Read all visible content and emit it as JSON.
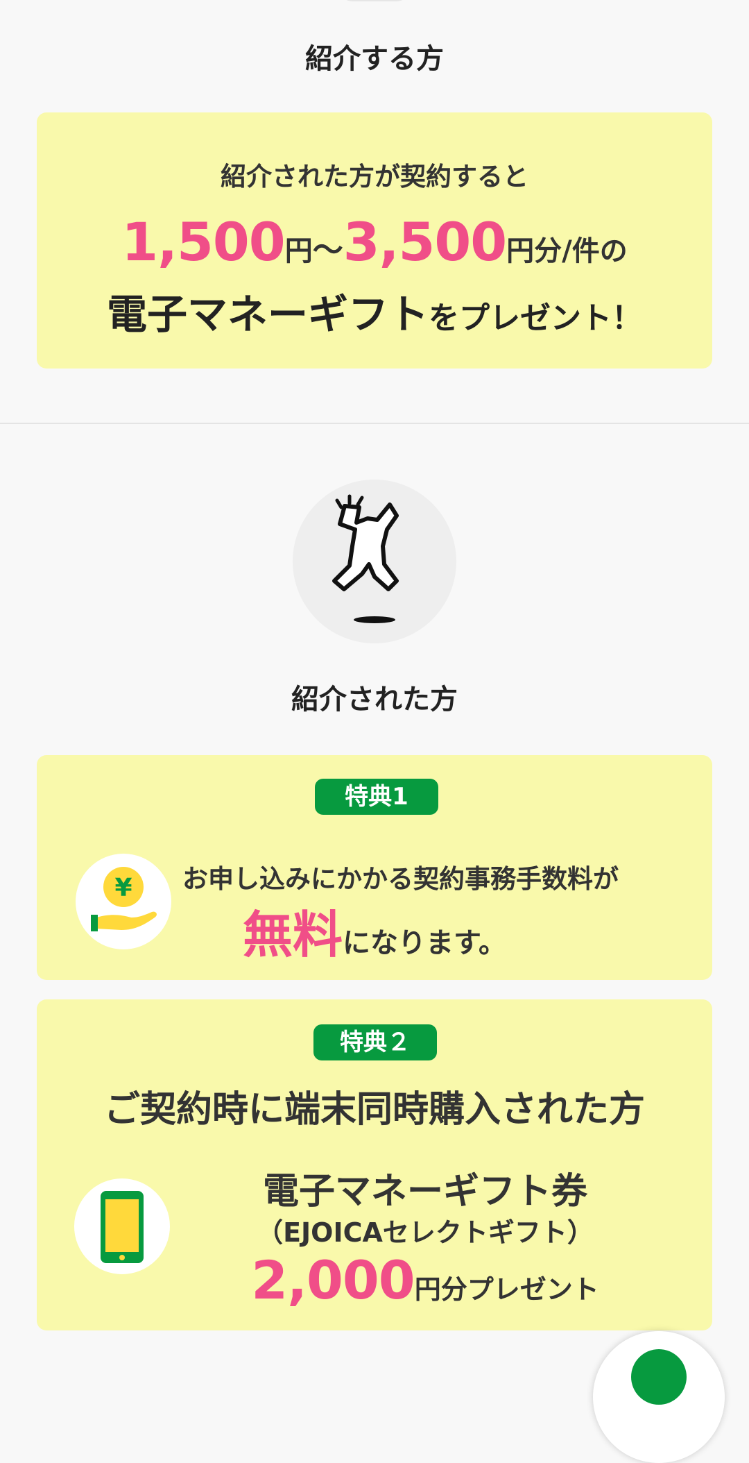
{
  "referrer": {
    "title": "紹介する方",
    "line1": "紹介された方が契約すると",
    "amount_low": "1,500",
    "yen": "円",
    "tilde": "～",
    "amount_high": "3,500",
    "suffix": "円分/件の",
    "gift_name": "電子マネーギフト",
    "gift_suffix": "をプレゼント！"
  },
  "referred": {
    "title": "紹介された方",
    "benefit1": {
      "badge": "特典1",
      "line1": "お申し込みにかかる契約事務手数料が",
      "highlight": "無料",
      "tail": "になります。"
    },
    "benefit2": {
      "badge": "特典２",
      "line1": "ご契約時に端末同時購入された方",
      "gift_name": "電子マネーギフト券",
      "gift_detail": "（EJOICAセレクトギフト）",
      "amount": "2,000",
      "tail": "円分プレゼント"
    }
  },
  "colors": {
    "card_bg": "#f9f9ab",
    "accent_pink": "#f04e88",
    "badge_green": "#079a3f",
    "coin_yellow": "#ffd93b"
  },
  "icons": {
    "avatar": "person-jumping-icon",
    "benefit1": "yen-coin-hand-icon",
    "benefit2": "smartphone-icon"
  }
}
